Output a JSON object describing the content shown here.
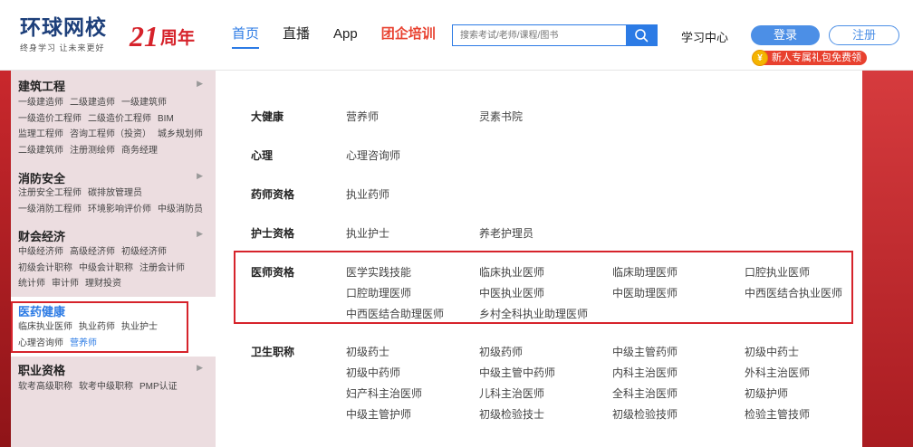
{
  "header": {
    "logo_main": "环球网校",
    "logo_sub": "终身学习 让未来更好",
    "anniv_num": "21",
    "anniv_txt": "周年",
    "nav": [
      {
        "label": "首页",
        "active": true
      },
      {
        "label": "直播"
      },
      {
        "label": "App"
      },
      {
        "label": "团企培训",
        "promo": true
      }
    ],
    "search_placeholder": "搜索考试/老师/课程/图书",
    "study_center": "学习中心",
    "login": "登录",
    "register": "注册",
    "gift_coin": "¥",
    "gift_text": "新人专属礼包免费领"
  },
  "sidebar": [
    {
      "title": "建筑工程",
      "links": [
        "一级建造师",
        "二级建造师",
        "一级建筑师",
        "一级造价工程师",
        "二级造价工程师",
        "BIM",
        "监理工程师",
        "咨询工程师（投资）",
        "城乡规划师",
        "二级建筑师",
        "注册测绘师",
        "商务经理"
      ]
    },
    {
      "title": "消防安全",
      "links": [
        "注册安全工程师",
        "碳排放管理员",
        "一级消防工程师",
        "环境影响评价师",
        "中级消防员"
      ]
    },
    {
      "title": "财会经济",
      "links": [
        "中级经济师",
        "高级经济师",
        "初级经济师",
        "初级会计职称",
        "中级会计职称",
        "注册会计师",
        "统计师",
        "审计师",
        "理财投资"
      ]
    },
    {
      "title": "医药健康",
      "links": [
        "临床执业医师",
        "执业药师",
        "执业护士",
        "心理咨询师",
        "营养师"
      ],
      "selected_link": "营养师"
    },
    {
      "title": "职业资格",
      "links": [
        "软考高级职称",
        "软考中级职称",
        "PMP认证"
      ]
    }
  ],
  "panel": [
    {
      "title": "大健康",
      "items": [
        "营养师",
        "灵素书院"
      ]
    },
    {
      "title": "心理",
      "items": [
        "心理咨询师"
      ]
    },
    {
      "title": "药师资格",
      "items": [
        "执业药师"
      ]
    },
    {
      "title": "护士资格",
      "items": [
        "执业护士",
        "养老护理员"
      ]
    },
    {
      "title": "医师资格",
      "items": [
        "医学实践技能",
        "临床执业医师",
        "临床助理医师",
        "口腔执业医师",
        "口腔助理医师",
        "中医执业医师",
        "中医助理医师",
        "中西医结合执业医师",
        "中西医结合助理医师",
        "乡村全科执业助理医师"
      ]
    },
    {
      "title": "卫生职称",
      "items": [
        "初级药士",
        "初级药师",
        "中级主管药师",
        "初级中药士",
        "初级中药师",
        "中级主管中药师",
        "内科主治医师",
        "外科主治医师",
        "妇产科主治医师",
        "儿科主治医师",
        "全科主治医师",
        "初级护师",
        "中级主管护师",
        "初级检验技士",
        "初级检验技师",
        "检验主管技师"
      ]
    }
  ]
}
